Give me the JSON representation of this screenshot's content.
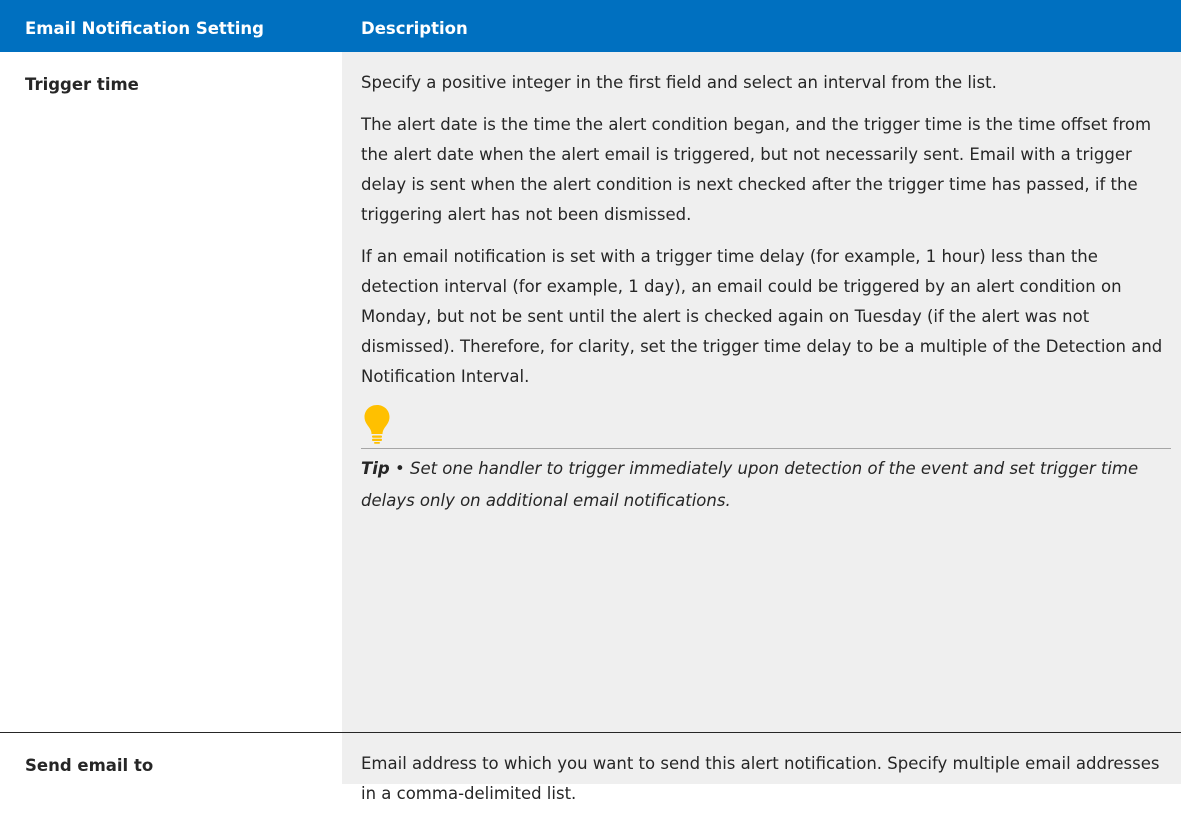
{
  "table": {
    "headers": {
      "setting": "Email Notification Setting",
      "description": "Description"
    },
    "rows": [
      {
        "setting": "Trigger time",
        "paragraphs": [
          "Specify a positive integer in the first field and select an interval from the list.",
          "The alert date is the time the alert condition began, and the trigger time is the time offset from the alert date when the alert email is triggered, but not necessarily sent. Email with a trigger delay is sent when the alert condition is next checked after the trigger time has passed, if the triggering alert has not been dismissed.",
          "If an email notification is set with a trigger time delay (for example, 1 hour) less than the detection interval (for example, 1 day), an email could be triggered by an alert condition on Monday, but not be sent until the alert is checked again on Tuesday (if the alert was not dismissed). Therefore, for clarity, set the trigger time delay to be a multiple of the Detection and Notification Interval."
        ],
        "tip": {
          "icon": "lightbulb-icon",
          "label": "Tip",
          "separator": " • ",
          "text": "Set one handler to trigger immediately upon detection of the event and set trigger time delays only on additional email notifications."
        }
      },
      {
        "setting": "Send email to",
        "paragraphs": [
          "Email address to which you want to send this alert notification. Specify multiple email addresses in a comma-delimited list."
        ]
      }
    ]
  },
  "colors": {
    "header_bg": "#0070c0",
    "header_text": "#ffffff",
    "description_bg": "#efefef",
    "tip_icon": "#ffc000"
  }
}
